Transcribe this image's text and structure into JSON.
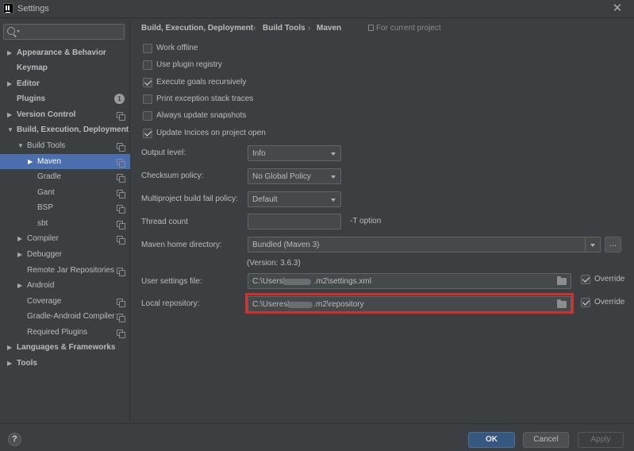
{
  "window": {
    "title": "Settings"
  },
  "sidebar": {
    "search_placeholder": "",
    "items": [
      {
        "label": "Appearance & Behavior"
      },
      {
        "label": "Keymap"
      },
      {
        "label": "Editor"
      },
      {
        "label": "Plugins",
        "badge": "1"
      },
      {
        "label": "Version Control"
      },
      {
        "label": "Build, Execution, Deployment"
      },
      {
        "label": "Build Tools"
      },
      {
        "label": "Maven"
      },
      {
        "label": "Gradle"
      },
      {
        "label": "Gant"
      },
      {
        "label": "BSP"
      },
      {
        "label": "sbt"
      },
      {
        "label": "Compiler"
      },
      {
        "label": "Debugger"
      },
      {
        "label": "Remote Jar Repositories"
      },
      {
        "label": "Android"
      },
      {
        "label": "Coverage"
      },
      {
        "label": "Gradle-Android Compiler"
      },
      {
        "label": "Required Plugins"
      },
      {
        "label": "Languages & Frameworks"
      },
      {
        "label": "Tools"
      }
    ]
  },
  "main": {
    "breadcrumb": [
      "Build, Execution, Deployment",
      "Build Tools",
      "Maven"
    ],
    "breadcrumb_sep": "›",
    "scope_label": "For current project",
    "checkboxes": [
      {
        "label": "Work offline",
        "checked": false
      },
      {
        "label": "Use plugin registry",
        "checked": false
      },
      {
        "label": "Execute goals recursively",
        "checked": true
      },
      {
        "label": "Print exception stack traces",
        "checked": false
      },
      {
        "label": "Always update snapshots",
        "checked": false
      },
      {
        "label": "Update Incices on project open",
        "checked": true
      }
    ],
    "output_level": {
      "label": "Output level:",
      "value": "Info"
    },
    "checksum_policy": {
      "label": "Checksum policy:",
      "value": "No Global Policy"
    },
    "multiproject_fail": {
      "label": "Multiproject build fail policy:",
      "value": "Default"
    },
    "thread_count": {
      "label": "Thread count",
      "value": "",
      "suffix": "-T option"
    },
    "maven_home": {
      "label": "Maven home directory:",
      "value": "Bundled (Maven 3)",
      "browse": "...",
      "version_note": "(Version: 3.6.3)"
    },
    "user_settings": {
      "label": "User settings file:",
      "value_prefix": "C:\\Users\\",
      "value_suffix": ".m2\\settings.xml",
      "override_label": "Override",
      "override_checked": true
    },
    "local_repo": {
      "label": "Local repository:",
      "value_prefix": "C:\\Useres\\",
      "value_suffix": ".m2\\repository",
      "override_label": "Override",
      "override_checked": true
    }
  },
  "footer": {
    "help": "?",
    "ok": "OK",
    "cancel": "Cancel",
    "apply": "Apply"
  }
}
